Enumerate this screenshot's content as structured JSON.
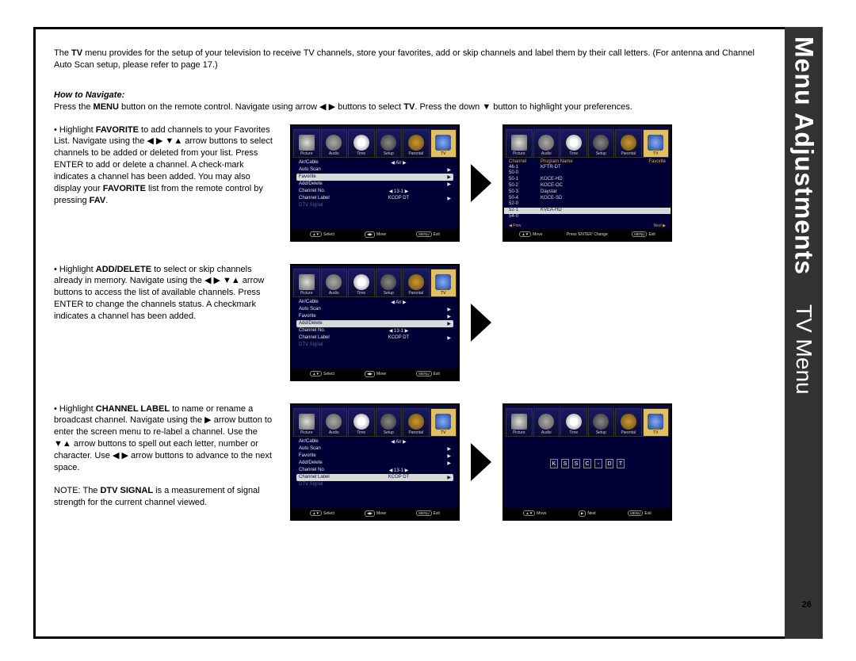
{
  "sidebar": {
    "title": "Menu Adjustments",
    "subtitle": "TV Menu"
  },
  "page_number": "26",
  "intro": {
    "pre": "The ",
    "b1": "TV",
    "post": " menu provides for the setup of your television to receive TV channels, store your favorites, add or skip channels and label them by their call letters.  (For antenna and Channel Auto Scan setup, please refer to page 17.)"
  },
  "how_heading": "How to Navigate:",
  "nav": {
    "a": "Press the ",
    "b1": "MENU",
    "b": " button on the remote control. Navigate using arrow ◀ ▶ buttons to select ",
    "b2": "TV",
    "c": ". Press the down ▼ button to highlight your preferences."
  },
  "sections": [
    {
      "lines": [
        "• Highlight ",
        "FAVORITE",
        " to add channels to your Favorites List. Navigate using the ◀ ▶ ▼▲ arrow buttons to select channels to be added or deleted from your list. Press ENTER to add or delete a channel. A check-mark indicates a channel has been added. You may also display your ",
        "FAVORITE",
        " list from the remote control by pressing ",
        "FAV",
        "."
      ]
    },
    {
      "lines": [
        "• Highlight ",
        "ADD/DELETE",
        " to select or skip channels already in memory. Navigate using the  ◀ ▶ ▼▲  arrow buttons to access the list of available channels. Press ENTER to change the channels status. A checkmark indicates a channel has been added."
      ]
    },
    {
      "lines": [
        "• Highlight ",
        "CHANNEL LABEL",
        " to name or rename a broadcast channel. Navigate using the ▶ arrow button to enter the screen menu to re-label a channel. Use the ▼▲ arrow buttons to spell out each letter, number or character. Use ◀ ▶ arrow buttons to advance to the next space."
      ],
      "note_pre": "NOTE: The ",
      "note_b": "DTV SIGNAL",
      "note_post": " is a measurement of signal strength for the current channel viewed."
    }
  ],
  "osd_tabs": [
    "Picture",
    "Audio",
    "Time",
    "Setup",
    "Parental",
    "TV"
  ],
  "menu_items": [
    {
      "label": "Air/Cable",
      "value": "Air",
      "arrows": true
    },
    {
      "label": "Auto Scan",
      "value": "",
      "chevron": true
    },
    {
      "label": "Favorite",
      "value": "",
      "chevron": true
    },
    {
      "label": "Add/Delete",
      "value": "",
      "chevron": true
    },
    {
      "label": "Channel No.",
      "value": "13-1",
      "arrows": true
    },
    {
      "label": "Channel Label",
      "value": "KCOP DT",
      "chevron": true
    },
    {
      "label": "DTV Signal",
      "value": "",
      "dim": true
    }
  ],
  "osd_footer": {
    "a": {
      "btn": "▲▼",
      "label": "Select"
    },
    "b": {
      "btn": "◀▶",
      "label": "Move"
    },
    "c": {
      "btn": "MENU",
      "label": "Exit"
    }
  },
  "fav_screen": {
    "headers": [
      "Channel",
      "Program Name",
      "Favorite"
    ],
    "rows": [
      {
        "ch": "46-1",
        "name": "KFTR-DT"
      },
      {
        "ch": "50-0",
        "name": ""
      },
      {
        "ch": "50-1",
        "name": "KOCE-HD"
      },
      {
        "ch": "50-2",
        "name": "KOCE-OC"
      },
      {
        "ch": "50-3",
        "name": "Daystar"
      },
      {
        "ch": "50-4",
        "name": "KOCE-SD"
      },
      {
        "ch": "52-0",
        "name": ""
      },
      {
        "ch": "52-1",
        "name": "KVEA-HD",
        "sel": true
      },
      {
        "ch": "54-0",
        "name": ""
      }
    ],
    "prev": "◀ Prev",
    "next": "Next ▶",
    "footer": {
      "a": {
        "btn": "▲▼",
        "label": "Move"
      },
      "b": {
        "label": "Press 'ENTER' Change"
      },
      "c": {
        "btn": "MENU",
        "label": "Exit"
      }
    }
  },
  "label_screen": {
    "letters": [
      "K",
      "S",
      "S",
      "C",
      "-",
      "D",
      "T"
    ],
    "footer": {
      "a": {
        "btn": "▲▼",
        "label": "Move"
      },
      "b": {
        "btn": "▶",
        "label": "Next"
      },
      "c": {
        "btn": "MENU",
        "label": "Exit"
      }
    }
  },
  "hl_index": {
    "fav": 2,
    "add": 3,
    "label": 5
  }
}
